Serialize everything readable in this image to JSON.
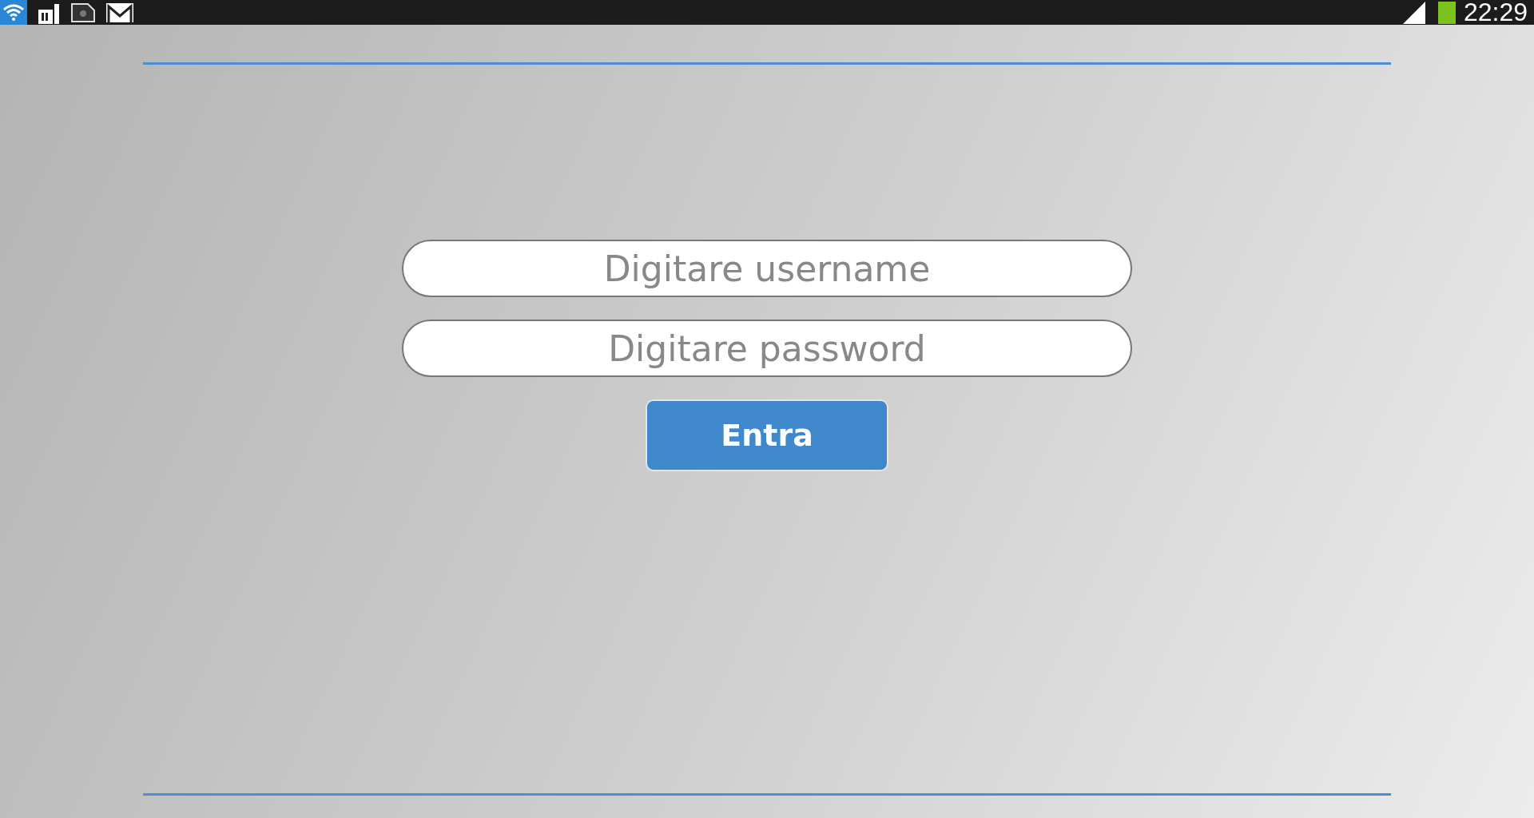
{
  "status_bar": {
    "time": "22:29"
  },
  "login": {
    "username": {
      "placeholder": "Digitare username"
    },
    "password": {
      "placeholder": "Digitare password"
    },
    "button": "Entra"
  }
}
